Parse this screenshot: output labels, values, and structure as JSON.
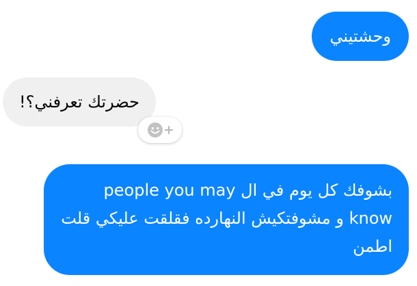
{
  "conversation": {
    "messages": [
      {
        "direction": "outgoing",
        "text": "وحشتيني"
      },
      {
        "direction": "incoming",
        "text": "حضرتك تعرفني؟!"
      },
      {
        "direction": "outgoing",
        "text": "بشوفك كل يوم في ال people you may know و مشوفتكيش النهارده فقلقت عليكي قلت اطمن"
      }
    ]
  },
  "icons": {
    "reaction_add": "add-reaction-icon",
    "reaction_face": "smiley-icon",
    "reaction_plus": "plus-icon"
  },
  "colors": {
    "outgoing_bubble": "#0b84ff",
    "incoming_bubble": "#f0f0f0",
    "reaction_icon": "#b9b9b9"
  }
}
